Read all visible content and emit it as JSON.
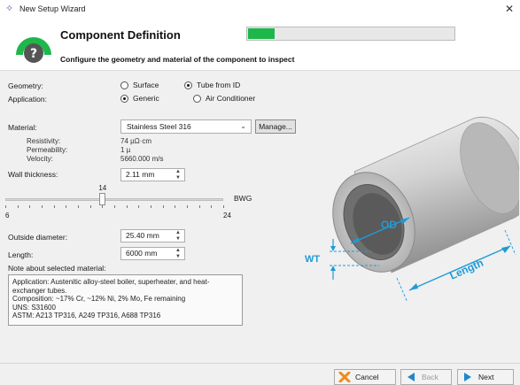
{
  "window": {
    "title": "New Setup Wizard",
    "close_glyph": "✕"
  },
  "header": {
    "title": "Component Definition",
    "subtitle": "Configure the geometry and material of the component to inspect",
    "progress_fraction": 0.13,
    "logo_icon": "help-question-icon",
    "colors": {
      "accent": "#1db74a",
      "logo_dark": "#555555"
    }
  },
  "geometry": {
    "label": "Geometry:",
    "options": [
      {
        "label": "Surface",
        "selected": false
      },
      {
        "label": "Tube from ID",
        "selected": true
      }
    ]
  },
  "application": {
    "label": "Application:",
    "options": [
      {
        "label": "Generic",
        "selected": true
      },
      {
        "label": "Air Conditioner",
        "selected": false
      }
    ]
  },
  "material": {
    "label": "Material:",
    "value": "Stainless Steel 316",
    "manage_label": "Manage...",
    "properties": [
      {
        "name": "Resistivity:",
        "value": "74 µΩ·cm"
      },
      {
        "name": "Permeability:",
        "value": "1 µ"
      },
      {
        "name": "Velocity:",
        "value": "5660.000 m/s"
      }
    ]
  },
  "wall_thickness": {
    "label": "Wall thickness:",
    "value": "2.11 mm",
    "slider": {
      "value": 14,
      "min": 6,
      "max": 24,
      "unit": "BWG",
      "value_label": "14",
      "min_label": "6",
      "max_label": "24"
    }
  },
  "outside_diameter": {
    "label": "Outside diameter:",
    "value": "25.40 mm"
  },
  "length": {
    "label": "Length:",
    "value": "6000 mm"
  },
  "note": {
    "label": "Note about selected material:",
    "lines": [
      "Application: Austenitic alloy-steel boiler, superheater, and heat-",
      "exchanger tubes.",
      "Composition: ~17% Cr, ~12% Ni, 2% Mo, Fe remaining",
      "UNS: S31600",
      "ASTM: A213 TP316, A249 TP316, A688 TP316"
    ]
  },
  "diagram": {
    "od_label": "OD",
    "wt_label": "WT",
    "length_label": "Length",
    "colors": {
      "dimension": "#1e9bd7"
    }
  },
  "footer": {
    "cancel_label": "Cancel",
    "back_label": "Back",
    "next_label": "Next",
    "colors": {
      "cancel_icon": "#f08a1c",
      "nav_icon": "#1e88c8"
    }
  }
}
